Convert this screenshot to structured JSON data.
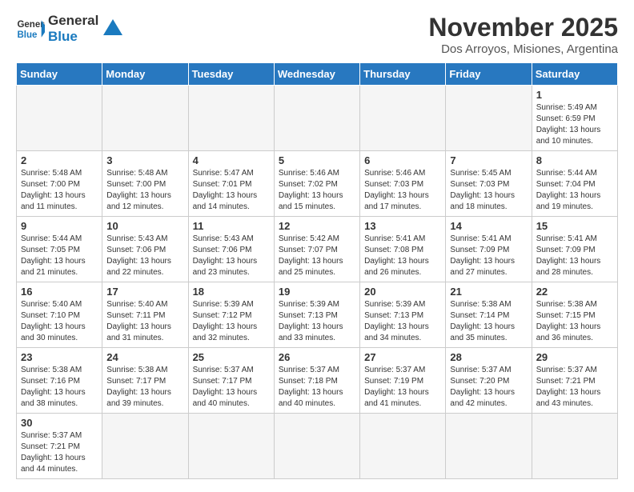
{
  "logo": {
    "text_general": "General",
    "text_blue": "Blue"
  },
  "header": {
    "month_year": "November 2025",
    "location": "Dos Arroyos, Misiones, Argentina"
  },
  "weekdays": [
    "Sunday",
    "Monday",
    "Tuesday",
    "Wednesday",
    "Thursday",
    "Friday",
    "Saturday"
  ],
  "weeks": [
    [
      {
        "day": "",
        "info": ""
      },
      {
        "day": "",
        "info": ""
      },
      {
        "day": "",
        "info": ""
      },
      {
        "day": "",
        "info": ""
      },
      {
        "day": "",
        "info": ""
      },
      {
        "day": "",
        "info": ""
      },
      {
        "day": "1",
        "info": "Sunrise: 5:49 AM\nSunset: 6:59 PM\nDaylight: 13 hours\nand 10 minutes."
      }
    ],
    [
      {
        "day": "2",
        "info": "Sunrise: 5:48 AM\nSunset: 7:00 PM\nDaylight: 13 hours\nand 11 minutes."
      },
      {
        "day": "3",
        "info": "Sunrise: 5:48 AM\nSunset: 7:00 PM\nDaylight: 13 hours\nand 12 minutes."
      },
      {
        "day": "4",
        "info": "Sunrise: 5:47 AM\nSunset: 7:01 PM\nDaylight: 13 hours\nand 14 minutes."
      },
      {
        "day": "5",
        "info": "Sunrise: 5:46 AM\nSunset: 7:02 PM\nDaylight: 13 hours\nand 15 minutes."
      },
      {
        "day": "6",
        "info": "Sunrise: 5:46 AM\nSunset: 7:03 PM\nDaylight: 13 hours\nand 17 minutes."
      },
      {
        "day": "7",
        "info": "Sunrise: 5:45 AM\nSunset: 7:03 PM\nDaylight: 13 hours\nand 18 minutes."
      },
      {
        "day": "8",
        "info": "Sunrise: 5:44 AM\nSunset: 7:04 PM\nDaylight: 13 hours\nand 19 minutes."
      }
    ],
    [
      {
        "day": "9",
        "info": "Sunrise: 5:44 AM\nSunset: 7:05 PM\nDaylight: 13 hours\nand 21 minutes."
      },
      {
        "day": "10",
        "info": "Sunrise: 5:43 AM\nSunset: 7:06 PM\nDaylight: 13 hours\nand 22 minutes."
      },
      {
        "day": "11",
        "info": "Sunrise: 5:43 AM\nSunset: 7:06 PM\nDaylight: 13 hours\nand 23 minutes."
      },
      {
        "day": "12",
        "info": "Sunrise: 5:42 AM\nSunset: 7:07 PM\nDaylight: 13 hours\nand 25 minutes."
      },
      {
        "day": "13",
        "info": "Sunrise: 5:41 AM\nSunset: 7:08 PM\nDaylight: 13 hours\nand 26 minutes."
      },
      {
        "day": "14",
        "info": "Sunrise: 5:41 AM\nSunset: 7:09 PM\nDaylight: 13 hours\nand 27 minutes."
      },
      {
        "day": "15",
        "info": "Sunrise: 5:41 AM\nSunset: 7:09 PM\nDaylight: 13 hours\nand 28 minutes."
      }
    ],
    [
      {
        "day": "16",
        "info": "Sunrise: 5:40 AM\nSunset: 7:10 PM\nDaylight: 13 hours\nand 30 minutes."
      },
      {
        "day": "17",
        "info": "Sunrise: 5:40 AM\nSunset: 7:11 PM\nDaylight: 13 hours\nand 31 minutes."
      },
      {
        "day": "18",
        "info": "Sunrise: 5:39 AM\nSunset: 7:12 PM\nDaylight: 13 hours\nand 32 minutes."
      },
      {
        "day": "19",
        "info": "Sunrise: 5:39 AM\nSunset: 7:13 PM\nDaylight: 13 hours\nand 33 minutes."
      },
      {
        "day": "20",
        "info": "Sunrise: 5:39 AM\nSunset: 7:13 PM\nDaylight: 13 hours\nand 34 minutes."
      },
      {
        "day": "21",
        "info": "Sunrise: 5:38 AM\nSunset: 7:14 PM\nDaylight: 13 hours\nand 35 minutes."
      },
      {
        "day": "22",
        "info": "Sunrise: 5:38 AM\nSunset: 7:15 PM\nDaylight: 13 hours\nand 36 minutes."
      }
    ],
    [
      {
        "day": "23",
        "info": "Sunrise: 5:38 AM\nSunset: 7:16 PM\nDaylight: 13 hours\nand 38 minutes."
      },
      {
        "day": "24",
        "info": "Sunrise: 5:38 AM\nSunset: 7:17 PM\nDaylight: 13 hours\nand 39 minutes."
      },
      {
        "day": "25",
        "info": "Sunrise: 5:37 AM\nSunset: 7:17 PM\nDaylight: 13 hours\nand 40 minutes."
      },
      {
        "day": "26",
        "info": "Sunrise: 5:37 AM\nSunset: 7:18 PM\nDaylight: 13 hours\nand 40 minutes."
      },
      {
        "day": "27",
        "info": "Sunrise: 5:37 AM\nSunset: 7:19 PM\nDaylight: 13 hours\nand 41 minutes."
      },
      {
        "day": "28",
        "info": "Sunrise: 5:37 AM\nSunset: 7:20 PM\nDaylight: 13 hours\nand 42 minutes."
      },
      {
        "day": "29",
        "info": "Sunrise: 5:37 AM\nSunset: 7:21 PM\nDaylight: 13 hours\nand 43 minutes."
      }
    ],
    [
      {
        "day": "30",
        "info": "Sunrise: 5:37 AM\nSunset: 7:21 PM\nDaylight: 13 hours\nand 44 minutes."
      },
      {
        "day": "",
        "info": ""
      },
      {
        "day": "",
        "info": ""
      },
      {
        "day": "",
        "info": ""
      },
      {
        "day": "",
        "info": ""
      },
      {
        "day": "",
        "info": ""
      },
      {
        "day": "",
        "info": ""
      }
    ]
  ]
}
